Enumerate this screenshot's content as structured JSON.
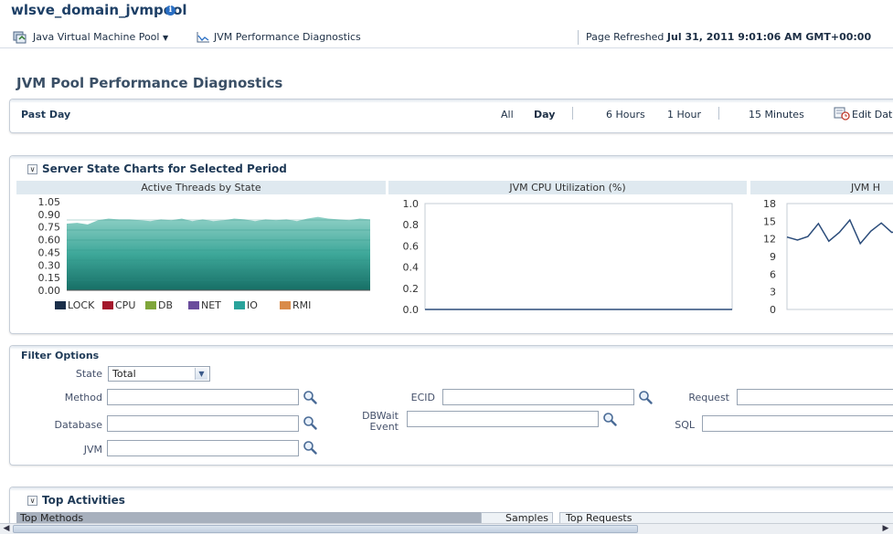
{
  "header": {
    "domain_title": "wlsve_domain_jvmpool",
    "info_icon": "i",
    "nav_menu_label": "Java Virtual Machine Pool",
    "nav_link_label": "JVM Performance Diagnostics",
    "refreshed_prefix": "Page Refreshed",
    "refreshed_value": "Jul 31, 2011 9:01:06 AM GMT+00:00"
  },
  "page_heading": "JVM Pool Performance Diagnostics",
  "time_range": {
    "current_label": "Past Day",
    "options": [
      "All",
      "Day",
      "6 Hours",
      "1 Hour",
      "15 Minutes"
    ],
    "selected": "Day",
    "edit_label": "Edit Dat"
  },
  "charts_section": {
    "title": "Server State Charts for Selected Period"
  },
  "chart_data": [
    {
      "type": "area",
      "title": "Active Threads by State",
      "ylim": [
        0,
        1.05
      ],
      "yticks": [
        "1.05",
        "0.90",
        "0.75",
        "0.60",
        "0.45",
        "0.30",
        "0.15",
        "0.00"
      ],
      "series": [
        {
          "name": "LOCK",
          "color": "#1b2f4a",
          "values": []
        },
        {
          "name": "CPU",
          "color": "#a4182c",
          "values": []
        },
        {
          "name": "DB",
          "color": "#7fa63a",
          "values": []
        },
        {
          "name": "NET",
          "color": "#6a4d9c",
          "values": []
        },
        {
          "name": "IO",
          "color": "#2aa39b",
          "values": [
            0.79,
            0.8,
            0.78,
            0.83,
            0.85,
            0.84,
            0.84,
            0.83,
            0.82,
            0.84,
            0.83,
            0.85,
            0.82,
            0.84,
            0.82,
            0.83,
            0.85,
            0.84,
            0.82,
            0.84,
            0.83,
            0.84,
            0.82,
            0.85,
            0.87,
            0.85,
            0.84,
            0.83,
            0.85,
            0.84
          ]
        },
        {
          "name": "RMI",
          "color": "#d98b4a",
          "values": []
        }
      ]
    },
    {
      "type": "line",
      "title": "JVM CPU Utilization (%)",
      "ylim": [
        0,
        1.0
      ],
      "yticks": [
        "1.0",
        "0.8",
        "0.6",
        "0.4",
        "0.2",
        "0.0"
      ],
      "series": [
        {
          "values": [
            0,
            0,
            0,
            0,
            0,
            0,
            0,
            0,
            0,
            0
          ]
        }
      ]
    },
    {
      "type": "line",
      "title": "JVM H",
      "ylim": [
        0,
        18
      ],
      "yticks": [
        "18",
        "15",
        "12",
        "9",
        "6",
        "3",
        "0"
      ],
      "series": [
        {
          "values": [
            12.3,
            11.8,
            12.4,
            14.6,
            11.6,
            13.1,
            15.2,
            11.2,
            13.3,
            14.7,
            13.1,
            13.4,
            14.5,
            11.1
          ]
        }
      ]
    }
  ],
  "filters": {
    "title": "Filter Options",
    "state_label": "State",
    "state_value": "Total",
    "method_label": "Method",
    "database_label": "Database",
    "jvm_label": "JVM",
    "ecid_label": "ECID",
    "dbwait_label_1": "DBWait",
    "dbwait_label_2": "Event",
    "request_label": "Request",
    "sql_label": "SQL",
    "method_value": "",
    "database_value": "",
    "jvm_value": "",
    "ecid_value": "",
    "dbwait_value": "",
    "request_value": "",
    "sql_value": ""
  },
  "top_activities": {
    "title": "Top Activities",
    "methods_header": "Top Methods",
    "samples_header": "Samples",
    "requests_header": "Top Requests"
  }
}
